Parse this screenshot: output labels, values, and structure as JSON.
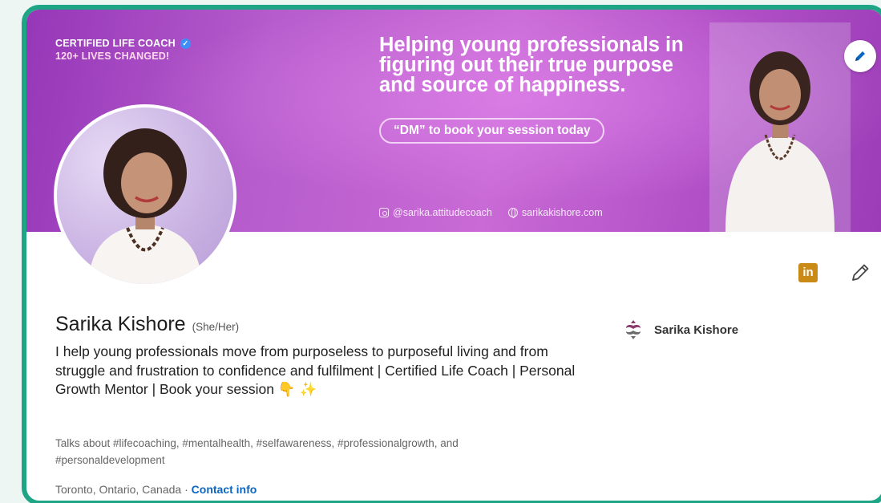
{
  "banner": {
    "certified_text": "CERTIFIED LIFE COACH",
    "lives_text": "120+ LIVES CHANGED!",
    "headline_lines": [
      "Helping young professionals in",
      "figuring out their true purpose",
      "and source of happiness."
    ],
    "cta": "“DM” to book your session today",
    "instagram": "@sarika.attitudecoach",
    "website": "sarikakishore.com"
  },
  "profile": {
    "name": "Sarika Kishore",
    "pronouns": "(She/Her)",
    "bio": "I help young professionals move from purposeless to purposeful living and from struggle and frustration to confidence and fulfilment | Certified Life Coach | Personal Growth Mentor | Book your session",
    "bio_emoji": "👇 ✨",
    "talks": "Talks about #lifecoaching, #mentalhealth, #selfawareness, #professionalgrowth, and #personaldevelopment",
    "location": "Toronto, Ontario, Canada",
    "separator": " · ",
    "contact_label": "Contact info"
  },
  "company": {
    "name": "Sarika Kishore"
  },
  "icons": {
    "linkedin": "in"
  },
  "colors": {
    "frame_border": "#1ea585",
    "banner_purple": "#b65ccc",
    "link_blue": "#0a66c2",
    "linkedin_badge": "#c98a16"
  }
}
